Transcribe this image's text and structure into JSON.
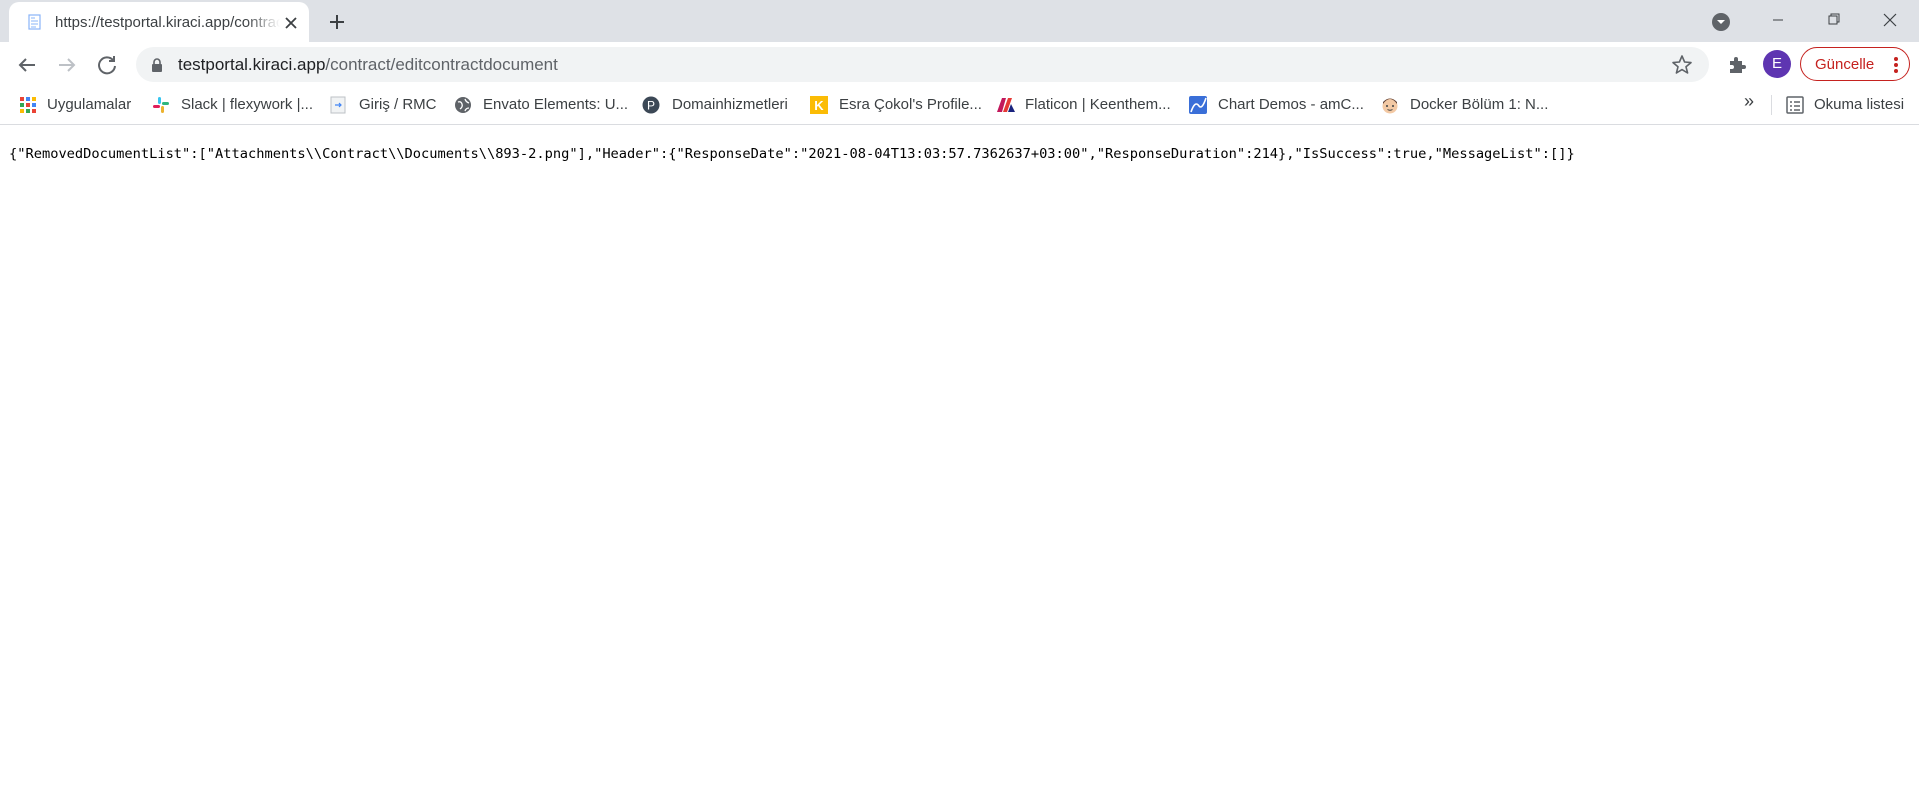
{
  "tab": {
    "title": "https://testportal.kiraci.app/contract/editcontractdocument"
  },
  "address_bar": {
    "host": "testportal.kiraci.app",
    "path": "/contract/editcontractdocument"
  },
  "profile": {
    "initial": "E",
    "color": "#5e35b1"
  },
  "update_button": {
    "label": "Güncelle",
    "color": "#c5221f"
  },
  "bookmarks": {
    "items": [
      {
        "label": "Uygulamalar",
        "icon": "apps-grid-icon"
      },
      {
        "label": "Slack | flexywork |...",
        "icon": "slack-icon"
      },
      {
        "label": "Giriş / RMC",
        "icon": "page-icon"
      },
      {
        "label": "Envato Elements: U...",
        "icon": "globe-icon"
      },
      {
        "label": "Domainhizmetleri",
        "icon": "p-circle-icon"
      },
      {
        "label": "Esra Çokol's Profile...",
        "icon": "k-logo-icon"
      },
      {
        "label": "Flaticon | Keenthem...",
        "icon": "flaticon-icon"
      },
      {
        "label": "Chart Demos - amC...",
        "icon": "amcharts-icon"
      },
      {
        "label": "Docker Bölüm 1: N...",
        "icon": "avatar-face-icon"
      }
    ],
    "more": "»",
    "reading_list": "Okuma listesi"
  },
  "page": {
    "json_text": "{\"RemovedDocumentList\":[\"Attachments\\\\Contract\\\\Documents\\\\893-2.png\"],\"Header\":{\"ResponseDate\":\"2021-08-04T13:03:57.7362637+03:00\",\"ResponseDuration\":214},\"IsSuccess\":true,\"MessageList\":[]}"
  }
}
